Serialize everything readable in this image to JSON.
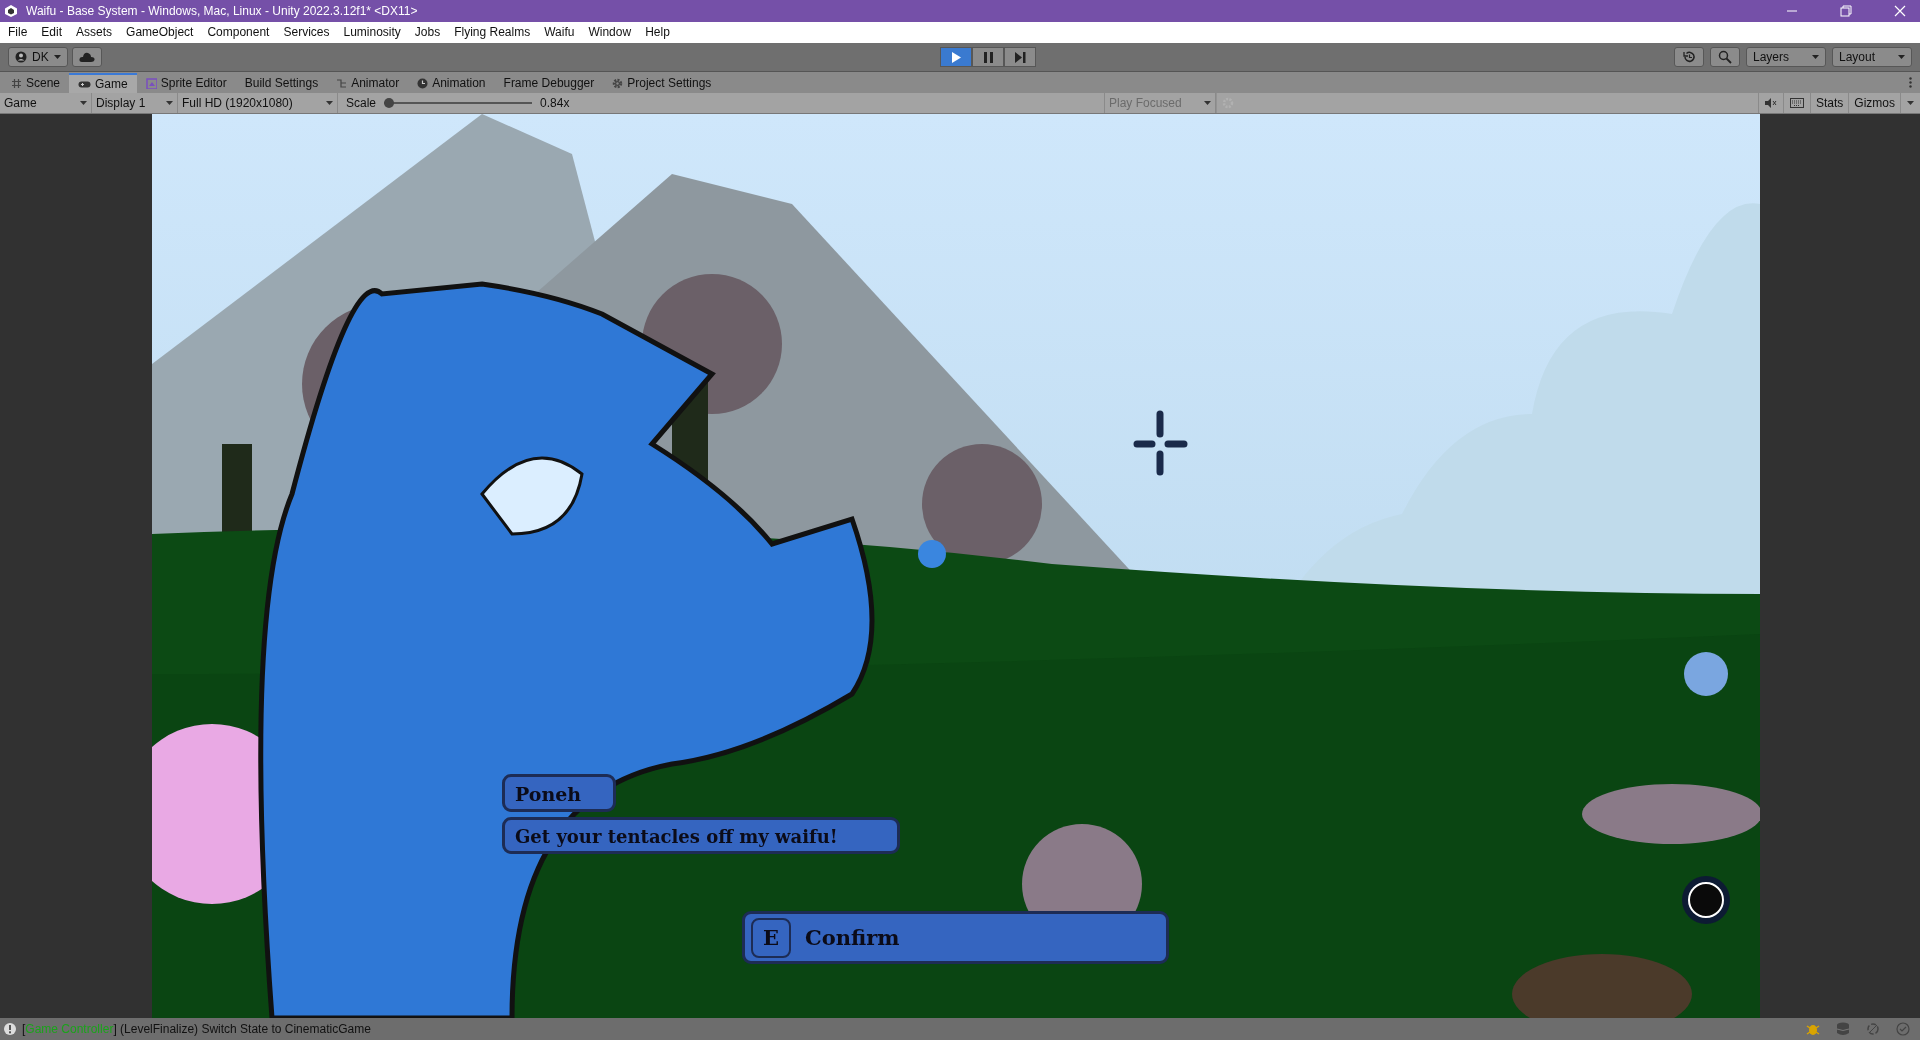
{
  "window": {
    "title": "Waifu - Base System - Windows, Mac, Linux - Unity 2022.3.12f1* <DX11>"
  },
  "menu": [
    "File",
    "Edit",
    "Assets",
    "GameObject",
    "Component",
    "Services",
    "Luminosity",
    "Jobs",
    "Flying Realms",
    "Waifu",
    "Window",
    "Help"
  ],
  "toolbar": {
    "account": "DK",
    "play": {
      "playing": true,
      "paused": false
    },
    "layers": "Layers",
    "layout": "Layout"
  },
  "tabs": [
    {
      "label": "Scene",
      "kind": "scene",
      "selected": false
    },
    {
      "label": "Game",
      "kind": "game",
      "selected": true
    },
    {
      "label": "Sprite Editor",
      "kind": "sprite",
      "selected": false
    },
    {
      "label": "Build Settings",
      "kind": "build",
      "selected": false
    },
    {
      "label": "Animator",
      "kind": "animator",
      "selected": false
    },
    {
      "label": "Animation",
      "kind": "animation",
      "selected": false
    },
    {
      "label": "Frame Debugger",
      "kind": "debugger",
      "selected": false
    },
    {
      "label": "Project Settings",
      "kind": "settings",
      "selected": false
    }
  ],
  "game_toolbar": {
    "view": "Game",
    "display": "Display 1",
    "resolution": "Full HD (1920x1080)",
    "scale_label": "Scale",
    "scale": {
      "level": 0.0
    },
    "scale_reading": "0.84x",
    "play_mode": {
      "label": "Play Focused",
      "disabled": true
    },
    "stats": "Stats",
    "gizmos": "Gizmos"
  },
  "game_view": {
    "speaker": "Poneh",
    "line": "Get your tentacles off my waifu!",
    "prompt": {
      "key": "E",
      "label": "Confirm"
    }
  },
  "status_bar": {
    "prefix": "[",
    "source": "Game Controller",
    "message": "] (LevelFinalize) Switch State to CinematicGame"
  }
}
